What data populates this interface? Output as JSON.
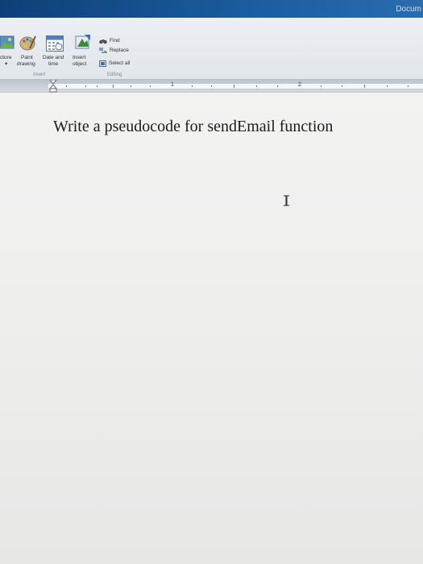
{
  "window": {
    "title": "Docum"
  },
  "ribbon": {
    "insert_group": {
      "label": "Insert",
      "buttons": [
        {
          "id": "picture",
          "label_lines": [
            "cture",
            "▾"
          ],
          "icon": "picture-icon"
        },
        {
          "id": "paint_drawing",
          "label_lines": [
            "Paint",
            "drawing"
          ],
          "icon": "paint-icon"
        },
        {
          "id": "date_time",
          "label_lines": [
            "Date and",
            "time"
          ],
          "icon": "calendar-icon"
        },
        {
          "id": "insert_object",
          "label_lines": [
            "Insert",
            "object"
          ],
          "icon": "insert-object-icon"
        }
      ]
    },
    "editing_group": {
      "label": "Editing",
      "commands": [
        {
          "id": "find",
          "label": "Find",
          "icon": "binoculars-icon"
        },
        {
          "id": "replace",
          "label": "Replace",
          "icon": "replace-icon"
        },
        {
          "id": "select_all",
          "label": "Select all",
          "icon": "select-all-icon"
        }
      ]
    }
  },
  "ruler": {
    "numbers": [
      "1",
      "2"
    ]
  },
  "document": {
    "text": "Write a pseudocode for sendEmail function"
  },
  "colors": {
    "titlebar": "#1b5d9e",
    "ribbon": "#e4e8ed",
    "page": "#efefee",
    "text": "#1c1c1c"
  }
}
